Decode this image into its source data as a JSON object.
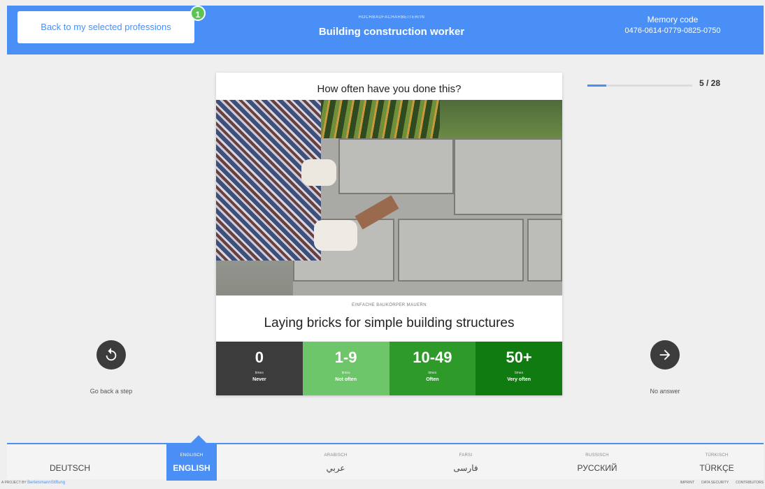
{
  "header": {
    "back_button": "Back to my selected professions",
    "badge_count": "1",
    "profession_subtitle": "HOCHBAUFACHARBEITER/IN",
    "profession_title": "Building construction worker",
    "memory_label": "Memory code",
    "memory_code": "0476-0614-0779-0825-0750"
  },
  "progress": {
    "text": "5 / 28",
    "fraction": 0.1786
  },
  "card": {
    "question": "How often have you done this?",
    "task_subtitle": "EINFACHE BAUKÖRPER MAUERN",
    "task_title": "Laying bricks for simple building structures",
    "answers": [
      {
        "num": "0",
        "times": "times",
        "freq": "Never"
      },
      {
        "num": "1-9",
        "times": "times",
        "freq": "Not often"
      },
      {
        "num": "10-49",
        "times": "times",
        "freq": "Often"
      },
      {
        "num": "50+",
        "times": "times",
        "freq": "Very often"
      }
    ]
  },
  "nav": {
    "back_label": "Go back a step",
    "back_icon": "undo-arrow-icon",
    "next_label": "No answer",
    "next_icon": "right-arrow-icon"
  },
  "languages": [
    {
      "native": "",
      "name": "DEUTSCH",
      "active": false
    },
    {
      "native": "ENGLISCH",
      "name": "ENGLISH",
      "active": true
    },
    {
      "native": "ARABISCH",
      "name": "عربي",
      "active": false
    },
    {
      "native": "FARSI",
      "name": "فارسی",
      "active": false
    },
    {
      "native": "RUSSISCH",
      "name": "РУССКИЙ",
      "active": false
    },
    {
      "native": "TÜRKISCH",
      "name": "TÜRKÇE",
      "active": false
    }
  ],
  "footer": {
    "project_prefix": "A PROJECT BY",
    "brand": "BertelsmannStiftung",
    "links": [
      "IMPRINT",
      "DATA SECURITY",
      "CONTRIBUTORS"
    ]
  },
  "colors": {
    "accent": "#4a8ff5",
    "never": "#3c3c3c",
    "not_often": "#6ec66a",
    "often": "#2e9a2a",
    "very_often": "#107b10"
  }
}
